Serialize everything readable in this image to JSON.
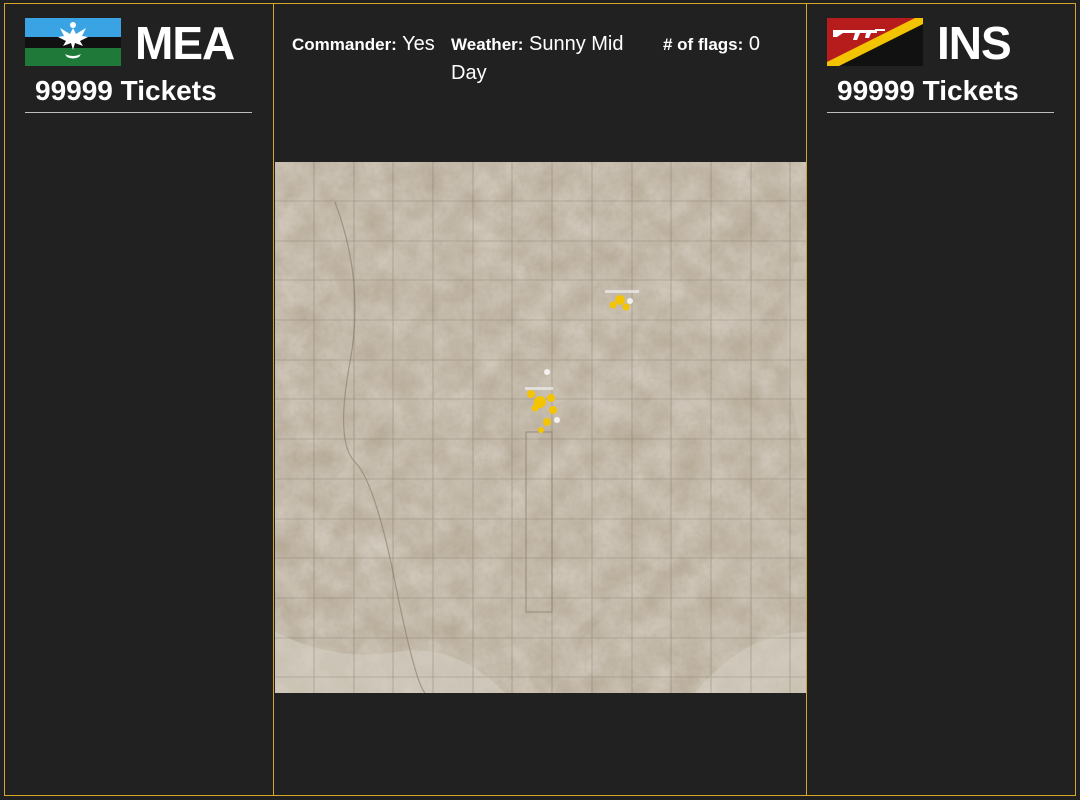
{
  "teams": {
    "left": {
      "code": "MEA",
      "tickets_value": "99999",
      "tickets_label": "Tickets",
      "flag_icon": "mea-flag-icon",
      "flag_colors": [
        "#3aa3e3",
        "#111111",
        "#1f7a3a",
        "#ffffff"
      ]
    },
    "right": {
      "code": "INS",
      "tickets_value": "99999",
      "tickets_label": "Tickets",
      "flag_icon": "ins-flag-icon",
      "flag_colors": [
        "#b71c1c",
        "#f2c400",
        "#111111",
        "#ffffff"
      ]
    }
  },
  "info": {
    "commander_label": "Commander:",
    "commander_value": "Yes",
    "weather_label": "Weather:",
    "weather_value": "Sunny Mid Day",
    "flags_label": "# of flags:",
    "flags_value": "0"
  },
  "colors": {
    "background": "#212121",
    "panel_border": "#d4a72a",
    "map_terrain": "#b7ab98",
    "marker": "#f5c400"
  }
}
